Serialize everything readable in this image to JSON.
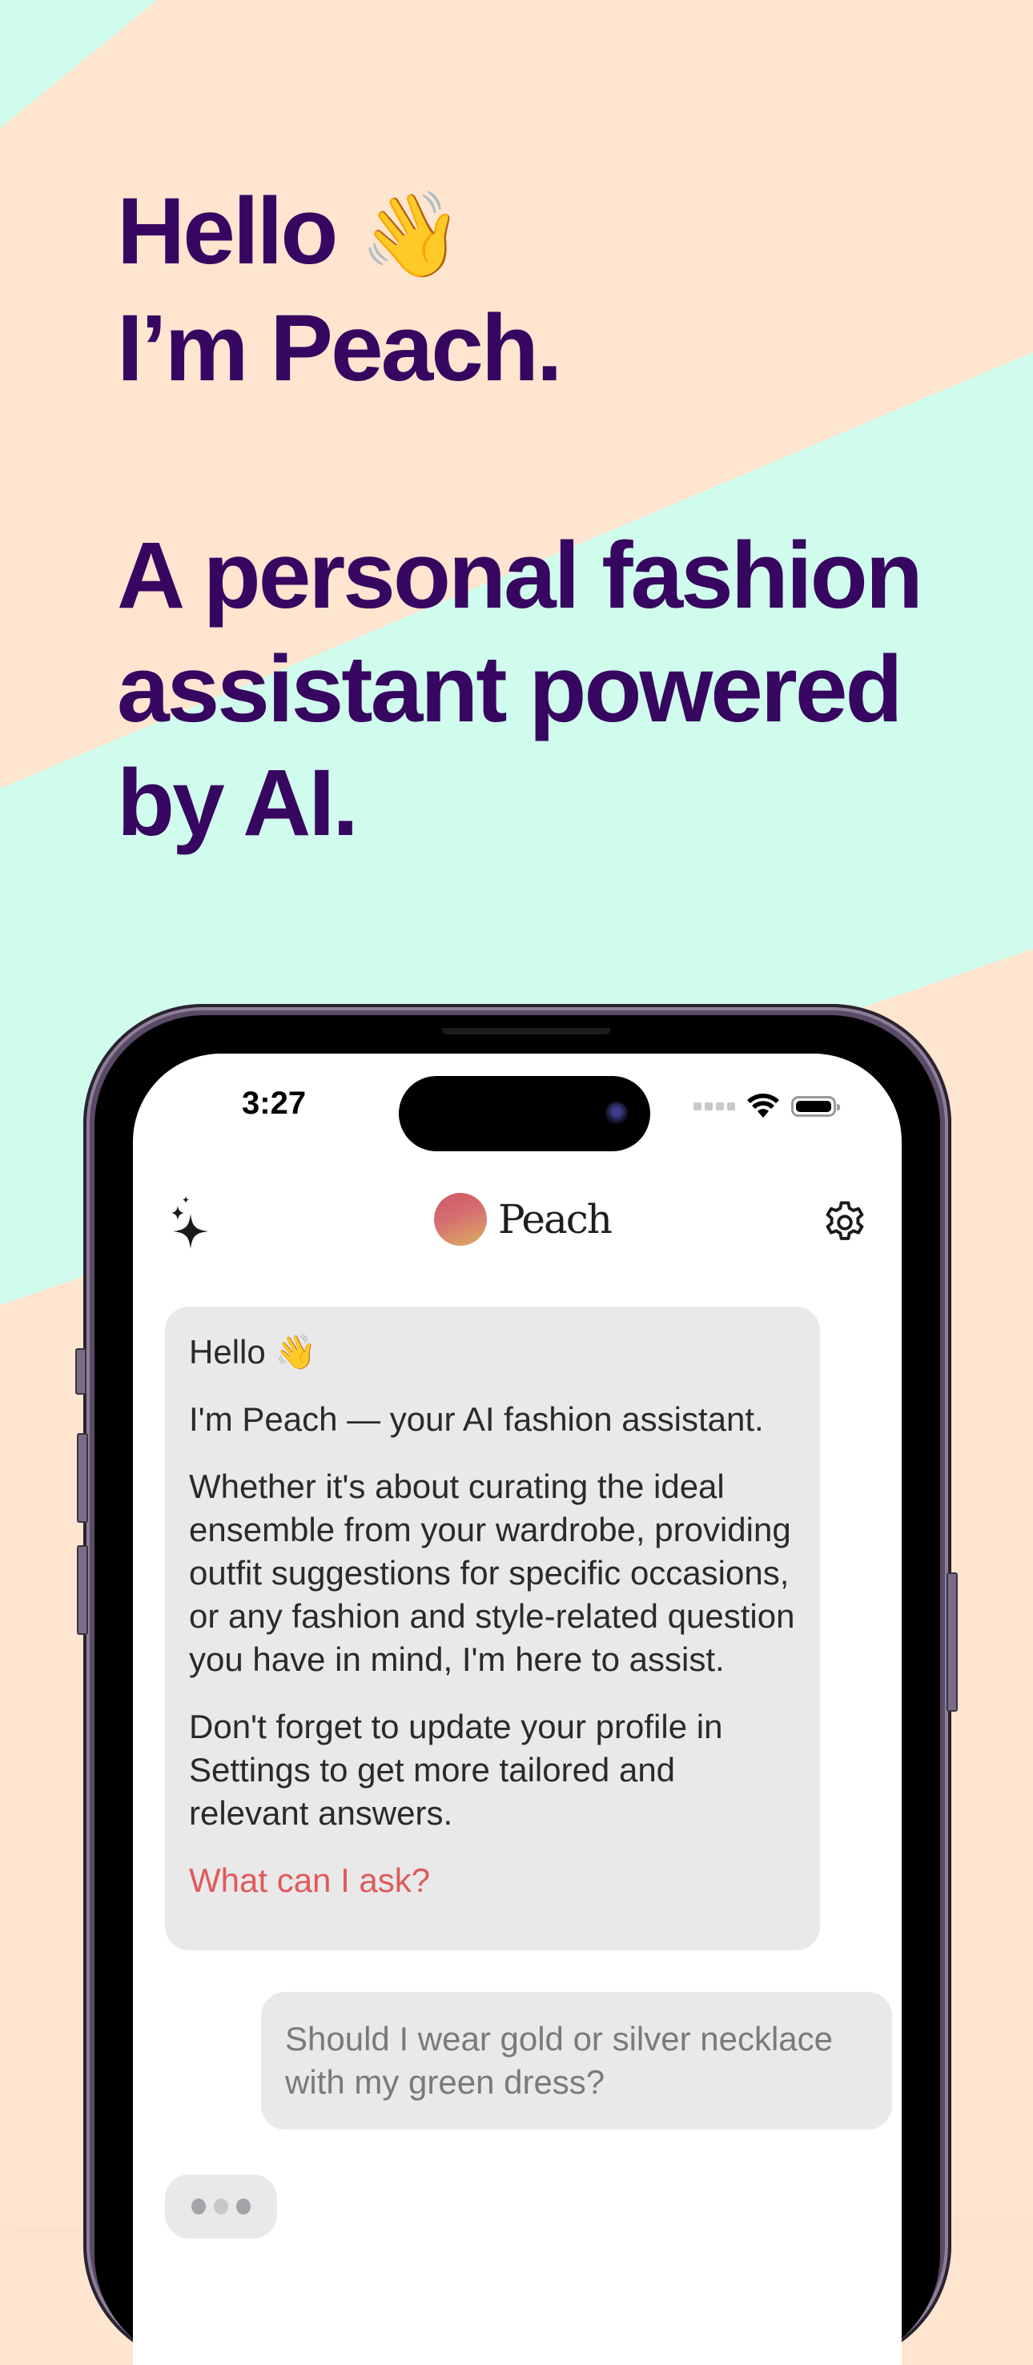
{
  "colors": {
    "background_peach": "#fee5d0",
    "background_mint": "#cffcec",
    "headline": "#370660",
    "bubble": "#e9e9ea",
    "link": "#e05a5a"
  },
  "hero": {
    "line1": "Hello",
    "line1_emoji": "👋",
    "line2": "I’m Peach.",
    "tagline_lines": [
      "A personal fashion",
      "assistant powered",
      "by AI."
    ]
  },
  "status_bar": {
    "time": "3:27",
    "icons": [
      "signal-dots-icon",
      "wifi-icon",
      "battery-icon"
    ]
  },
  "navbar": {
    "left_icon": "sparkles-icon",
    "brand_name": "Peach",
    "right_icon": "gear-icon"
  },
  "chat": {
    "bot_message": {
      "greeting": "Hello",
      "greeting_emoji": "👋",
      "paragraphs": [
        "I'm Peach — your AI fashion assistant.",
        "Whether it's about curating the ideal ensemble from your wardrobe, providing outfit suggestions for specific occasions, or any fashion and style-related question you have in mind, I'm here to assist.",
        "Don't forget to update your profile in Settings to get more tailored and relevant answers."
      ],
      "link": "What can I ask?"
    },
    "user_message": "Should I wear gold or silver necklace with my green dress?",
    "typing_indicator": "typing"
  }
}
